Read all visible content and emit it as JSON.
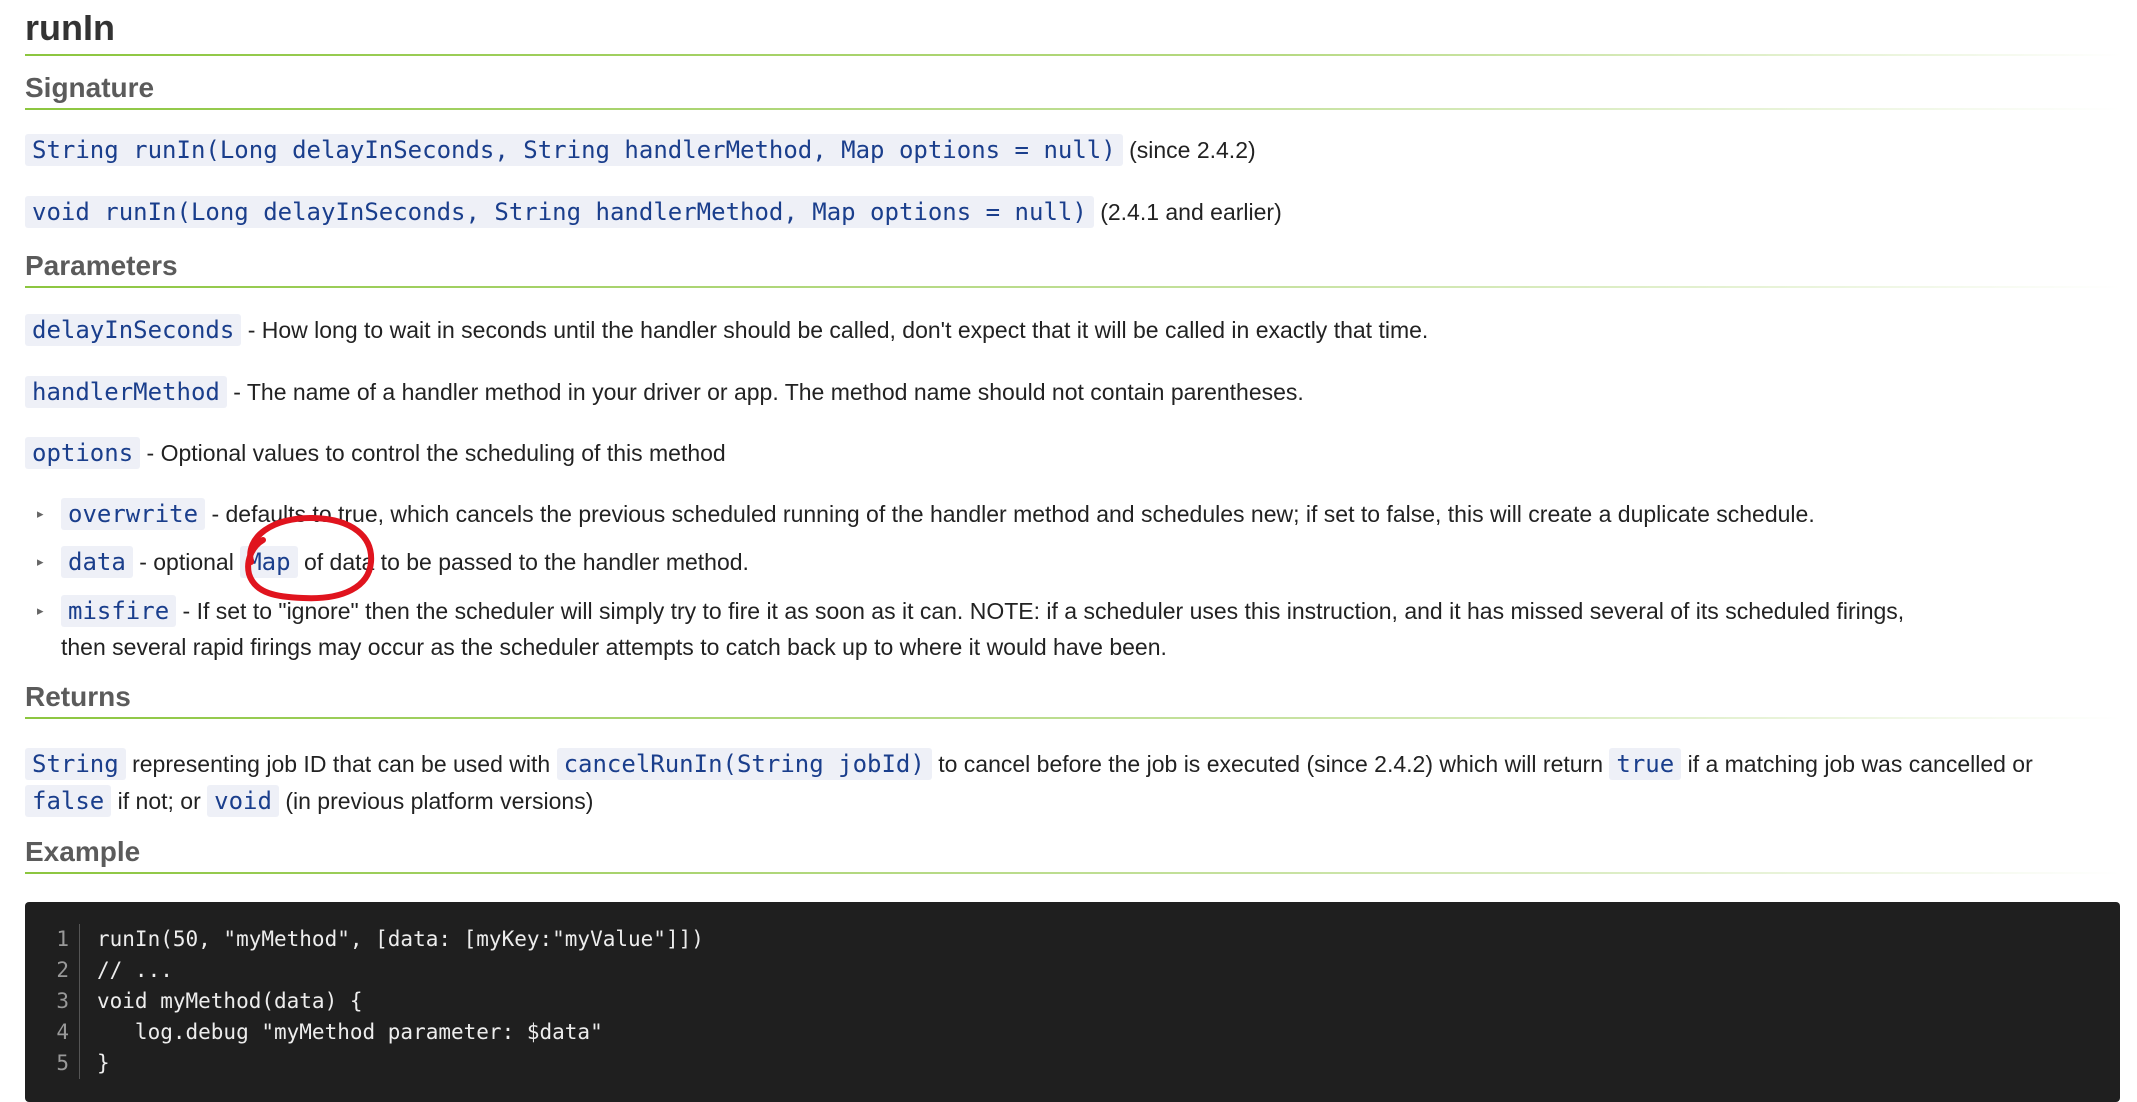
{
  "title": "runIn",
  "sections": {
    "signature": "Signature",
    "parameters": "Parameters",
    "returns": "Returns",
    "example": "Example"
  },
  "signature": [
    {
      "code": "String runIn(Long delayInSeconds, String handlerMethod, Map options = null)",
      "note": "(since 2.4.2)"
    },
    {
      "code": "void runIn(Long delayInSeconds, String handlerMethod, Map options = null)",
      "note": "(2.4.1 and earlier)"
    }
  ],
  "params": [
    {
      "name": "delayInSeconds",
      "desc": "- How long to wait in seconds until the handler should be called, don't expect that it will be called in exactly that time."
    },
    {
      "name": "handlerMethod",
      "desc": "- The name of a handler method in your driver or app. The method name should not contain parentheses."
    },
    {
      "name": "options",
      "desc": "- Optional values to control the scheduling of this method"
    }
  ],
  "options": {
    "overwrite": {
      "name": "overwrite",
      "desc": "- defaults to true, which cancels the previous scheduled running of the handler method and schedules new; if set to false, this will create a duplicate schedule."
    },
    "data": {
      "name": "data",
      "pre": "- optional",
      "code": "Map",
      "post": "of data to be passed to the handler method."
    },
    "misfire": {
      "name": "misfire",
      "desc": "- If set to \"ignore\" then the scheduler will simply try to fire it as soon as it can. NOTE: if a scheduler uses this instruction, and it has missed several of its scheduled firings,",
      "desc2": "then several rapid firings may occur as the scheduler attempts to catch back up to where it would have been."
    }
  },
  "returns": {
    "c1": "String",
    "t1": "representing job ID that can be used with",
    "c2": "cancelRunIn(String jobId)",
    "t2": "to cancel before the job is executed (since 2.4.2) which will return",
    "c3": "true",
    "t3": "if a matching job was cancelled or",
    "c4": "false",
    "t4": "if not; or",
    "c5": "void",
    "t5": "(in previous platform versions)"
  },
  "example": {
    "line_numbers": [
      "1",
      "2",
      "3",
      "4",
      "5"
    ],
    "lines": [
      "runIn(50, \"myMethod\", [data: [myKey:\"myValue\"]])",
      "// ...",
      "void myMethod(data) {",
      "   log.debug \"myMethod parameter: $data\"",
      "}"
    ]
  },
  "colors": {
    "accent_green": "#8cc63f",
    "code_text": "#1a3e8c",
    "code_bg": "#eef0f7",
    "codeblock_bg": "#1f1f1f",
    "annotation_red": "#e0141e"
  }
}
